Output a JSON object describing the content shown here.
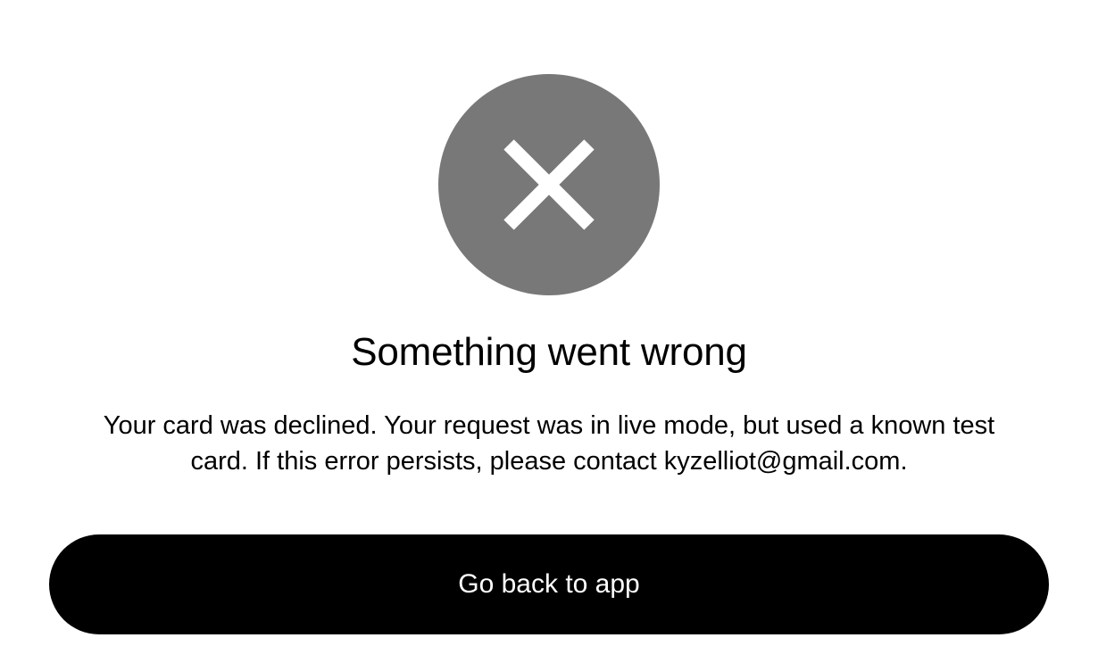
{
  "error": {
    "icon": "close-icon",
    "icon_background": "#787878",
    "title": "Something went wrong",
    "message": "Your card was declined. Your request was in live mode, but used a known test card. If this error persists, please contact kyzelliot@gmail.com."
  },
  "actions": {
    "back_label": "Go back to app",
    "button_color": "#000000"
  }
}
